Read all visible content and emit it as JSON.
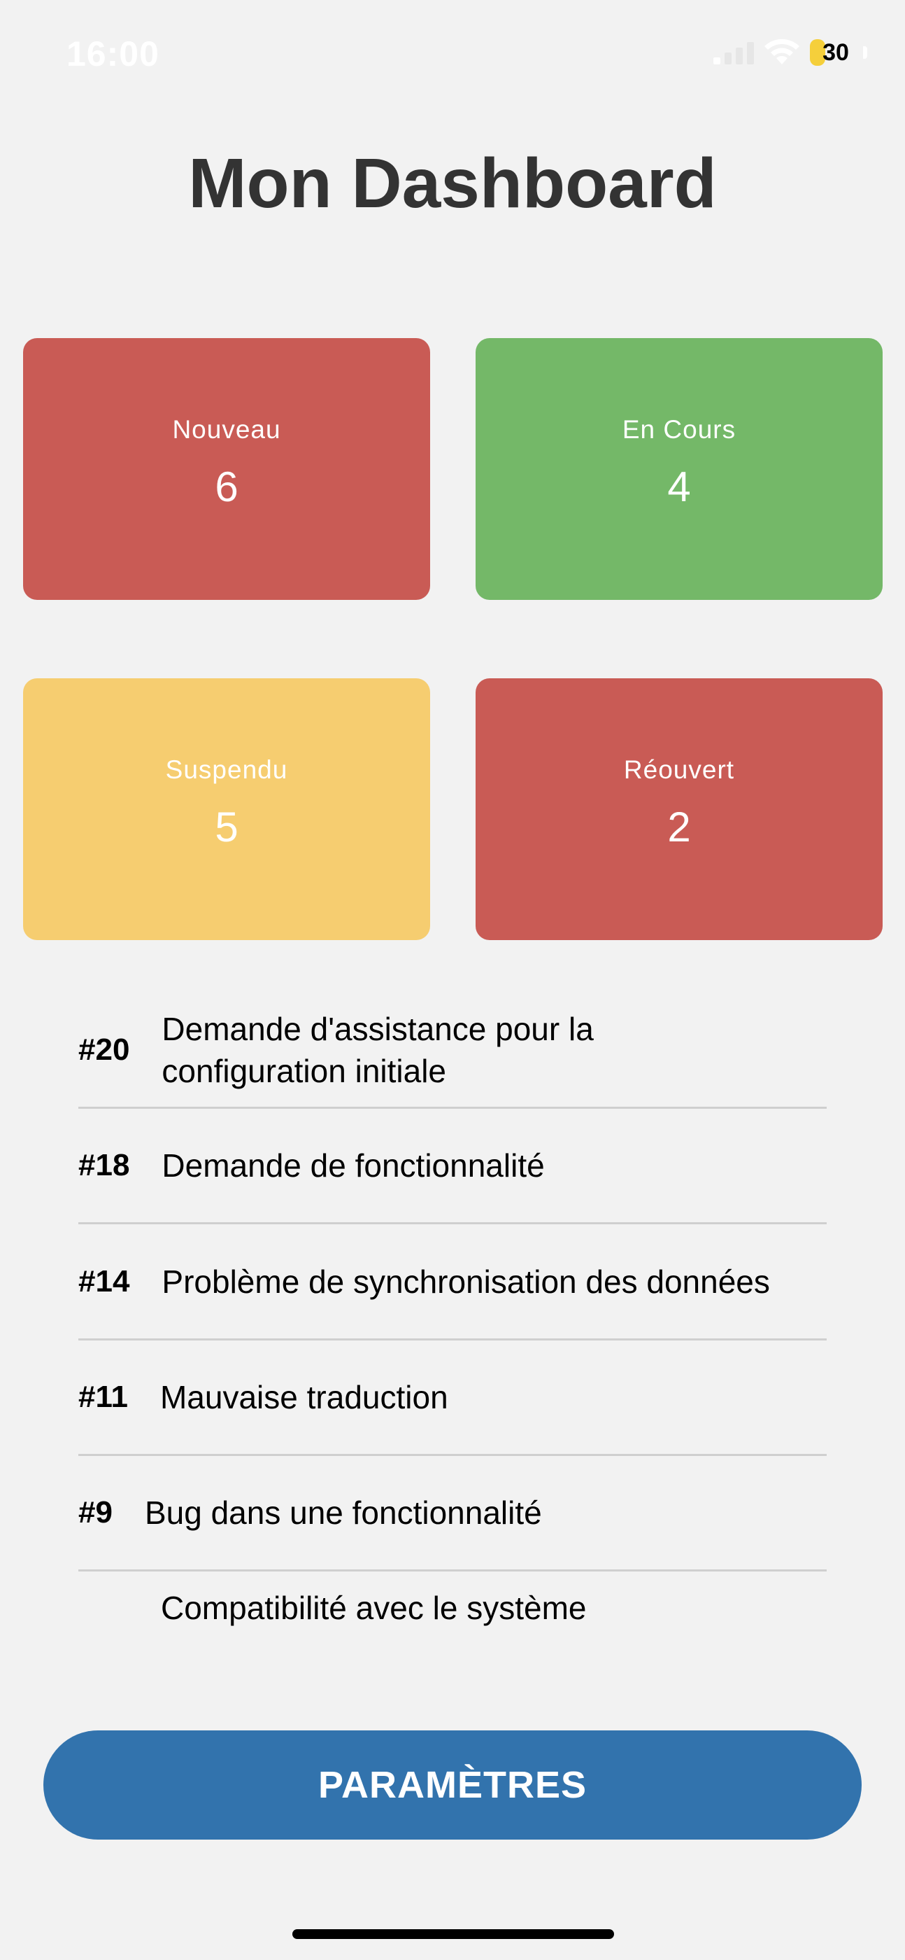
{
  "status_bar": {
    "time": "16:00",
    "battery": "30",
    "battery_level": 0.3
  },
  "title": "Mon Dashboard",
  "stats": [
    {
      "label": "Nouveau",
      "value": "6",
      "color": "#c95b55"
    },
    {
      "label": "En Cours",
      "value": "4",
      "color": "#74b868"
    },
    {
      "label": "Suspendu",
      "value": "5",
      "color": "#f6cd70"
    },
    {
      "label": "Réouvert",
      "value": "2",
      "color": "#c95b55"
    }
  ],
  "tickets": [
    {
      "id": "#20",
      "title": "Demande d'assistance pour la configuration initiale"
    },
    {
      "id": "#18",
      "title": "Demande de fonctionnalité"
    },
    {
      "id": "#14",
      "title": "Problème de synchronisation des données"
    },
    {
      "id": "#11",
      "title": "Mauvaise traduction"
    },
    {
      "id": "#9",
      "title": "Bug dans une fonctionnalité"
    },
    {
      "id": "",
      "title": "Compatibilité avec le système"
    }
  ],
  "settings_button": "PARAMÈTRES"
}
